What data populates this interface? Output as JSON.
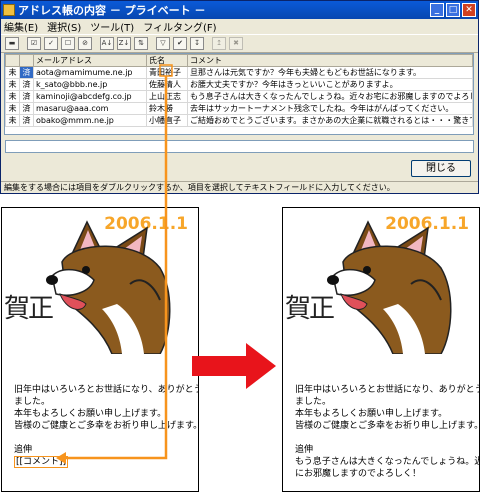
{
  "window": {
    "title": "アドレス帳の内容 － プライベート －",
    "menu": [
      "編集(E)",
      "選択(S)",
      "ツール(T)",
      "フィルタング(F)"
    ],
    "columns": [
      "",
      "",
      "メールアドレス",
      "氏名",
      "コメント"
    ],
    "rows": [
      [
        "未",
        "済",
        "aota@mamimume.ne.jp",
        "青田裕子",
        "旦那さんは元気ですか？今年も夫婦ともどもお世話になります。"
      ],
      [
        "未",
        "済",
        "k_sato@bbb.ne.jp",
        "佐藤清人",
        "お腰大丈夫ですか？今年はきっといいことがありますよ。"
      ],
      [
        "未",
        "済",
        "kaminoji@abcdefg.co.jp",
        "上山正志",
        "もう息子さんは大きくなったんでしょうね。近々お宅にお邪魔しますのでよろしく！"
      ],
      [
        "未",
        "済",
        "masaru@aaa.com",
        "鈴木勝",
        "去年はサッカートーナメント残念でしたね。今年はがんばってください。"
      ],
      [
        "未",
        "済",
        "obako@mmm.ne.jp",
        "小幡直子",
        "ご結婚おめでとうございます。まさかあの大企業に就職されるとは・・・驚きです。"
      ]
    ],
    "textfield_value": "",
    "close_button": "閉じる",
    "status_text": "編集をする場合には項目をダブルクリックするか、項目を選択してテキストフィールドに入力してください。"
  },
  "card_left": {
    "date": "2006.1.1",
    "kanji": "賀正",
    "body": [
      "旧年中はいろいろとお世話になり、ありがとうござい",
      "ました。",
      "本年もよろしくお願い申し上げます。",
      "皆様のご健康とご多幸をお祈り申し上げます。"
    ],
    "tsuishin": "追伸",
    "placeholder": "[[コメント]]"
  },
  "card_right": {
    "date": "2006.1.1",
    "kanji": "賀正",
    "body": [
      "旧年中はいろいろとお世話になり、ありがとうござい",
      "ました。",
      "本年もよろしくお願い申し上げます。",
      "皆様のご健康とご多幸をお祈り申し上げます。"
    ],
    "tsuishin": "追伸",
    "comment_lines": [
      "もう息子さんは大きくなったんでしょうね。近々お宅",
      "にお邪魔しますのでよろしく！"
    ]
  },
  "colors": {
    "accent_orange": "#f7941d",
    "arrow_red": "#e8141b",
    "selection_blue": "#316ac5",
    "titlebar_blue": "#0a5ad8"
  }
}
